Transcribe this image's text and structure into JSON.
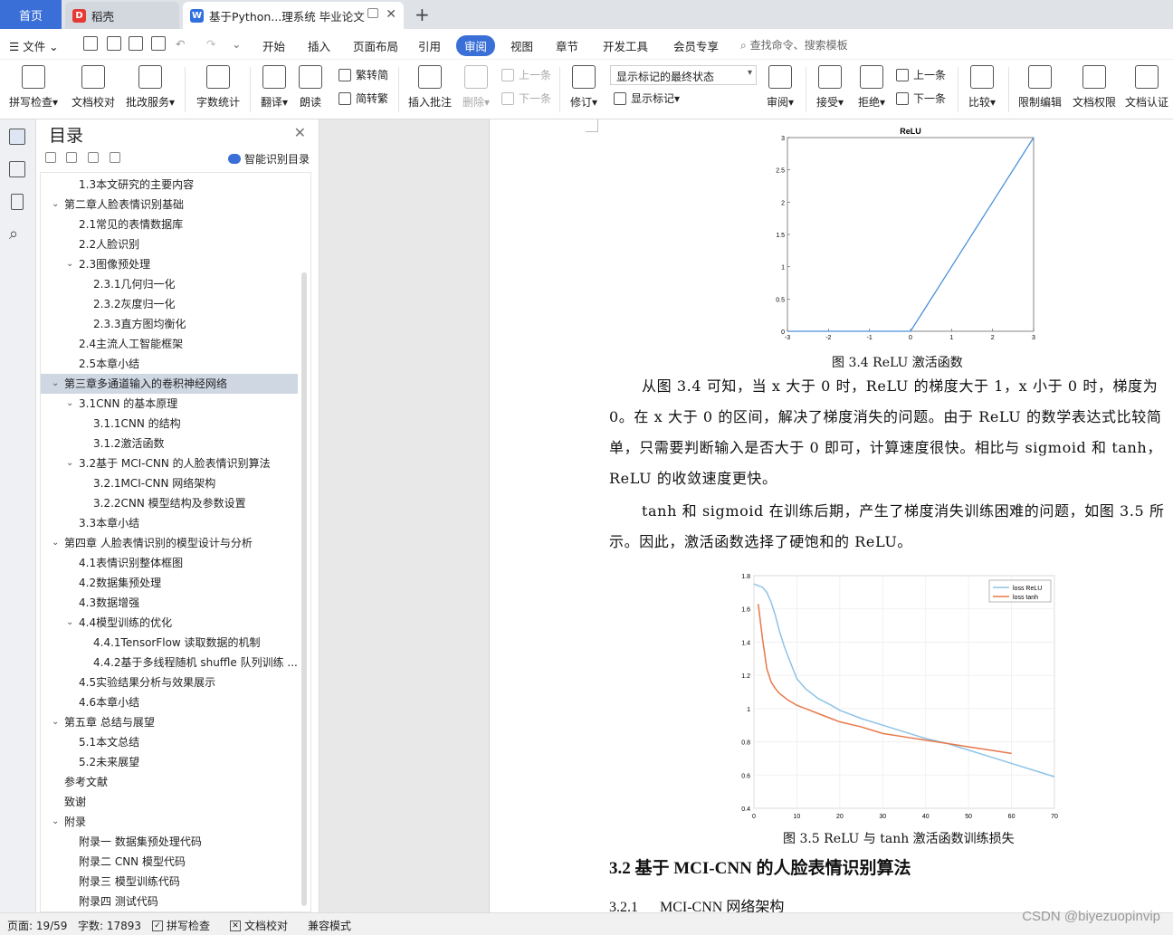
{
  "tabs": {
    "home": "首页",
    "t1": "稻壳",
    "t2": "基于Python...理系统 毕业论文"
  },
  "menu": {
    "file": "文件",
    "items": [
      "开始",
      "插入",
      "页面布局",
      "引用",
      "审阅",
      "视图",
      "章节",
      "开发工具",
      "会员专享"
    ],
    "active_index": 4,
    "search": "查找命令、搜索模板"
  },
  "ribbon": {
    "spell": "拼写检查",
    "proof": "文档校对",
    "batch": "批改服务",
    "count": "字数统计",
    "translate": "翻译",
    "read": "朗读",
    "trad": "繁转简",
    "simp": "简转繁",
    "insert_comment": "插入批注",
    "delete": "删除",
    "prev1": "上一条",
    "next1": "下一条",
    "revise": "修订",
    "display_state": "显示标记的最终状态",
    "show_marks": "显示标记",
    "review": "审阅",
    "accept": "接受",
    "reject": "拒绝",
    "prev2": "上一条",
    "next2": "下一条",
    "compare": "比较",
    "limit": "限制编辑",
    "perm": "文档权限",
    "auth": "文档认证"
  },
  "toc": {
    "title": "目录",
    "smart": "智能识别目录",
    "items": [
      {
        "t": "1.3本文研究的主要内容",
        "l": 2
      },
      {
        "t": "第二章人脸表情识别基础",
        "l": 1,
        "c": 1
      },
      {
        "t": "2.1常见的表情数据库",
        "l": 2
      },
      {
        "t": "2.2人脸识别",
        "l": 2
      },
      {
        "t": "2.3图像预处理",
        "l": 2,
        "c": 1
      },
      {
        "t": "2.3.1几何归一化",
        "l": 3
      },
      {
        "t": "2.3.2灰度归一化",
        "l": 3
      },
      {
        "t": "2.3.3直方图均衡化",
        "l": 3
      },
      {
        "t": "2.4主流人工智能框架",
        "l": 2
      },
      {
        "t": "2.5本章小结",
        "l": 2
      },
      {
        "t": "第三章多通道输入的卷积神经网络",
        "l": 1,
        "c": 1,
        "s": 1
      },
      {
        "t": "3.1CNN 的基本原理",
        "l": 2,
        "c": 1
      },
      {
        "t": "3.1.1CNN 的结构",
        "l": 3
      },
      {
        "t": "3.1.2激活函数",
        "l": 3
      },
      {
        "t": "3.2基于 MCI-CNN 的人脸表情识别算法",
        "l": 2,
        "c": 1
      },
      {
        "t": "3.2.1MCI-CNN 网络架构",
        "l": 3
      },
      {
        "t": "3.2.2CNN 模型结构及参数设置",
        "l": 3
      },
      {
        "t": "3.3本章小结",
        "l": 2
      },
      {
        "t": "第四章  人脸表情识别的模型设计与分析",
        "l": 1,
        "c": 1
      },
      {
        "t": "4.1表情识别整体框图",
        "l": 2
      },
      {
        "t": "4.2数据集预处理",
        "l": 2
      },
      {
        "t": "4.3数据增强",
        "l": 2
      },
      {
        "t": "4.4模型训练的优化",
        "l": 2,
        "c": 1
      },
      {
        "t": "4.4.1TensorFlow 读取数据的机制",
        "l": 3
      },
      {
        "t": "4.4.2基于多线程随机 shuffle 队列训练 ...",
        "l": 3
      },
      {
        "t": "4.5实验结果分析与效果展示",
        "l": 2
      },
      {
        "t": "4.6本章小结",
        "l": 2
      },
      {
        "t": "第五章  总结与展望",
        "l": 1,
        "c": 1
      },
      {
        "t": "5.1本文总结",
        "l": 2
      },
      {
        "t": "5.2未来展望",
        "l": 2
      },
      {
        "t": "参考文献",
        "l": 1
      },
      {
        "t": "致谢",
        "l": 1
      },
      {
        "t": "附录",
        "l": 1,
        "c": 1
      },
      {
        "t": "附录一  数据集预处理代码",
        "l": 2
      },
      {
        "t": "附录二  CNN 模型代码",
        "l": 2
      },
      {
        "t": "附录三  模型训练代码",
        "l": 2
      },
      {
        "t": "附录四  测试代码",
        "l": 2
      }
    ]
  },
  "doc": {
    "fig1_caption": "图 3.4 ReLU 激活函数",
    "para1": "从图 3.4 可知，当 x 大于 0 时，ReLU 的梯度大于 1，x 小于 0 时，梯度为 0。在 x 大于 0 的区间，解决了梯度消失的问题。由于 ReLU 的数学表达式比较简单，只需要判断输入是否大于 0 即可，计算速度很快。相比与 sigmoid 和 tanh，ReLU 的收敛速度更快。",
    "para2": "tanh 和 sigmoid 在训练后期，产生了梯度消失训练困难的问题，如图 3.5 所示。因此，激活函数选择了硬饱和的 ReLU。",
    "fig2_caption": "图 3.5 ReLU 与 tanh 激活函数训练损失",
    "heading": "3.2 基于 MCI-CNN 的人脸表情识别算法",
    "subheading_num": "3.2.1",
    "subheading": "MCI-CNN 网络架构"
  },
  "chart_data": [
    {
      "type": "line",
      "title": "ReLU",
      "x": [
        -3,
        -2,
        -1,
        0,
        1,
        2,
        3
      ],
      "y": [
        0,
        0,
        0,
        0,
        1,
        2,
        3
      ],
      "xlim": [
        -3,
        3
      ],
      "ylim": [
        0,
        3
      ],
      "xticks": [
        "-3",
        "-2",
        "-1",
        "0",
        "1",
        "2",
        "3"
      ],
      "yticks": [
        "0",
        "0.5",
        "1",
        "1.5",
        "2",
        "2.5",
        "3"
      ],
      "color": "#4a90d9"
    },
    {
      "type": "line",
      "xlim": [
        0,
        70
      ],
      "ylim": [
        0.4,
        1.8
      ],
      "grid": true,
      "legend": "top-right",
      "xticks": [
        "0",
        "10",
        "20",
        "30",
        "40",
        "50",
        "60",
        "70"
      ],
      "yticks": [
        "0.4",
        "0.6",
        "0.8",
        "1",
        "1.2",
        "1.4",
        "1.6",
        "1.8"
      ],
      "series": [
        {
          "name": "loss ReLU",
          "color": "#8ec3e6",
          "x": [
            0,
            1,
            2,
            3,
            4,
            5,
            6,
            7,
            8,
            10,
            12,
            15,
            18,
            20,
            25,
            30,
            35,
            40,
            45,
            50,
            55,
            60,
            65,
            70
          ],
          "y": [
            1.75,
            1.74,
            1.73,
            1.7,
            1.64,
            1.56,
            1.46,
            1.38,
            1.31,
            1.18,
            1.12,
            1.06,
            1.02,
            0.99,
            0.94,
            0.9,
            0.86,
            0.82,
            0.79,
            0.75,
            0.71,
            0.67,
            0.63,
            0.59
          ]
        },
        {
          "name": "loss tanh",
          "color": "#e8784a",
          "x": [
            1,
            2,
            3,
            4,
            5,
            6,
            8,
            10,
            12,
            15,
            18,
            20,
            25,
            30,
            35,
            40,
            45,
            50,
            55,
            60
          ],
          "y": [
            1.63,
            1.42,
            1.24,
            1.16,
            1.12,
            1.09,
            1.05,
            1.02,
            1.0,
            0.97,
            0.94,
            0.92,
            0.89,
            0.85,
            0.83,
            0.81,
            0.79,
            0.77,
            0.75,
            0.73
          ]
        }
      ]
    }
  ],
  "status": {
    "page": "页面: 19/59",
    "words": "字数: 17893",
    "spell": "拼写检查",
    "proof": "文档校对",
    "compat": "兼容模式"
  },
  "watermark": "CSDN @biyezuopinvip"
}
